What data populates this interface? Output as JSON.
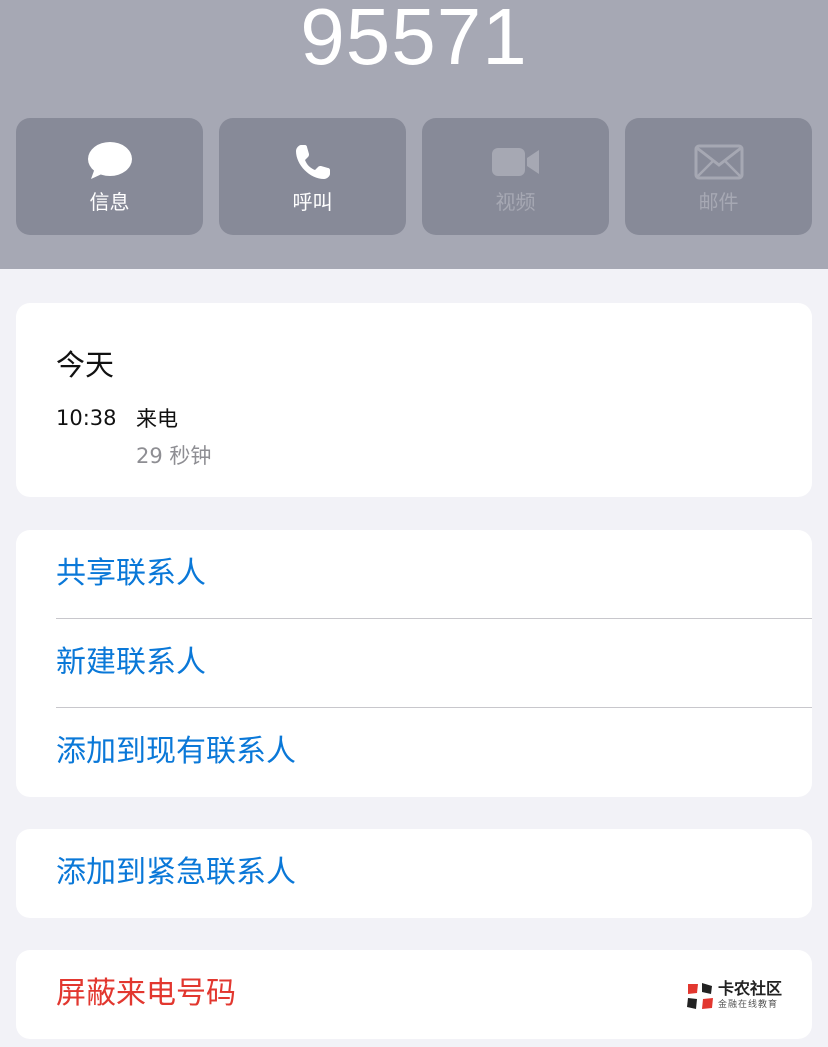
{
  "contact": {
    "number": "95571"
  },
  "actions": [
    {
      "label": "信息",
      "icon": "message-bubble-icon",
      "enabled": true
    },
    {
      "label": "呼叫",
      "icon": "phone-icon",
      "enabled": true
    },
    {
      "label": "视频",
      "icon": "video-camera-icon",
      "enabled": false
    },
    {
      "label": "邮件",
      "icon": "mail-envelope-icon",
      "enabled": false
    }
  ],
  "recents": {
    "day": "今天",
    "time": "10:38",
    "type": "来电",
    "duration": "29 秒钟"
  },
  "contact_options": [
    {
      "label": "共享联系人"
    },
    {
      "label": "新建联系人"
    },
    {
      "label": "添加到现有联系人"
    }
  ],
  "emergency": {
    "label": "添加到紧急联系人"
  },
  "block": {
    "label": "屏蔽来电号码"
  },
  "watermark": {
    "title": "卡农社区",
    "subtitle": "金融在线教育"
  },
  "colors": {
    "header_bg": "#a6a8b4",
    "action_bg": "#878a98",
    "link_blue": "#0a78d8",
    "destructive_red": "#e2372f",
    "page_bg": "#f2f2f7"
  }
}
